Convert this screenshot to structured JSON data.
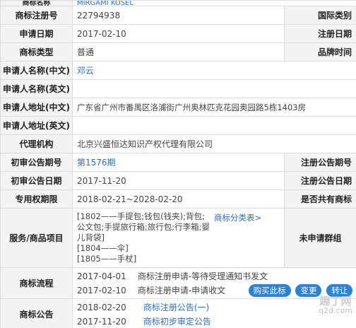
{
  "rows": {
    "name": {
      "label": "商标名称",
      "value": "MIRGAMI KOSEL"
    },
    "reg_no": {
      "label": "商标注册号",
      "value": "22794938",
      "right_label": "国际类别",
      "right_value": ""
    },
    "apply_date": {
      "label": "申请日期",
      "value": "2017-02-10",
      "right_label": "注册日期",
      "right_value": ""
    },
    "type": {
      "label": "商标类型",
      "value": "普通",
      "right_label": "品牌时间",
      "right_value": ""
    },
    "applicant_cn": {
      "label": "申请人名称(中文)",
      "value": "邓云"
    },
    "applicant_en": {
      "label": "申请人名称(英文)",
      "value": ""
    },
    "address_cn": {
      "label": "申请人地址(中文)",
      "value": "广东省广州市番禺区洛浦街广州奥林匹克花园奥园路5栋1403房"
    },
    "address_en": {
      "label": "申请人地址(英文)",
      "value": ""
    },
    "agency": {
      "label": "代理机构",
      "value": "北京兴盛恒达知识产权代理有限公司"
    },
    "prelim_no": {
      "label": "初审公告期号",
      "value": "第1576期",
      "right_label": "注册公告期号",
      "right_value": ""
    },
    "prelim_date": {
      "label": "初审公告日期",
      "value": "2017-11-20",
      "right_label": "注册公告日期",
      "right_value": ""
    },
    "exclusive": {
      "label": "专用权期限",
      "value": "2018-02-21~2028-02-20",
      "right_label": "是否共有商标",
      "right_value": ""
    },
    "goods": {
      "label": "服务/商品项目",
      "lines": [
        "[1802——手提包;钱包(钱夹);背包;",
        "公文包;手提旅行箱;旅行包;行李箱;婴",
        "儿背袋]",
        "[1804——伞]",
        "[1805——手杖]"
      ],
      "class_link": "商标分类表>",
      "right_label": "未申请群组",
      "right_value": ""
    },
    "flow": {
      "label": "商标流程",
      "items": [
        {
          "date": "2017-04-01",
          "desc": "商标注册申请-等待受理通知书发文"
        },
        {
          "date": "2017-02-10",
          "desc": "商标注册申请-申请收文"
        }
      ],
      "buttons": {
        "buy": "购买此标",
        "change": "变更",
        "transfer": "转让"
      }
    },
    "notice": {
      "label": "商标公告",
      "items": [
        {
          "date": "2018-02-20",
          "link": "商标注册公告(一)"
        },
        {
          "date": "2017-11-20",
          "link": "商标初步审定公告"
        }
      ]
    }
  },
  "watermark": {
    "line1": "趣丁网",
    "line2": "q2d.com"
  },
  "colors": {
    "label_bg": "#f3f3f3",
    "link": "#2a6fc9",
    "button": "#2b83d6",
    "border": "#dcdcdc"
  }
}
